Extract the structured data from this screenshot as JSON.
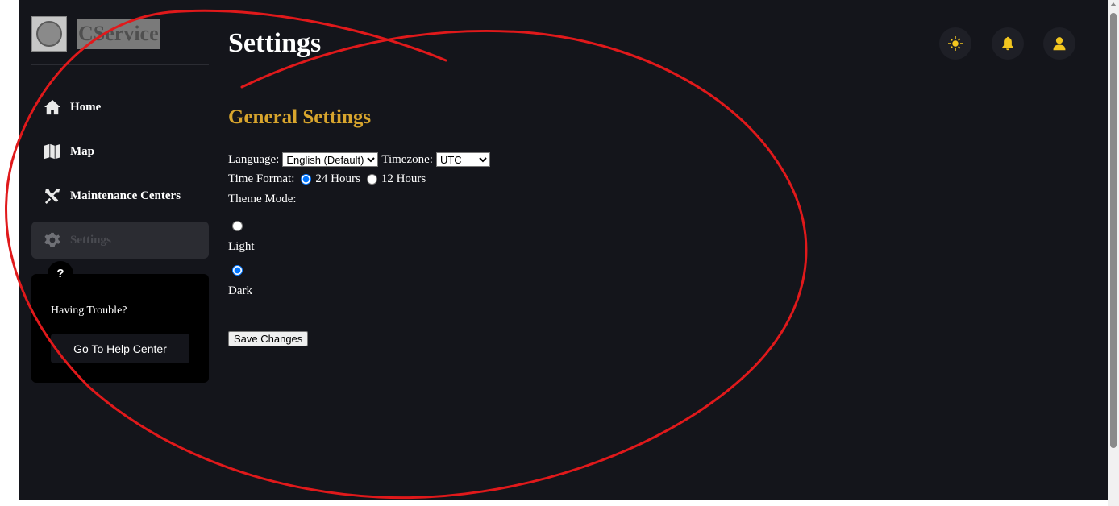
{
  "brand": {
    "name": "CService"
  },
  "sidebar": {
    "items": [
      {
        "label": "Home",
        "icon": "home-icon"
      },
      {
        "label": "Map",
        "icon": "map-icon"
      },
      {
        "label": "Maintenance Centers",
        "icon": "tools-icon"
      },
      {
        "label": "Settings",
        "icon": "gear-icon",
        "active": true
      }
    ]
  },
  "help": {
    "badge": "?",
    "text": "Having Trouble?",
    "button": "Go To Help Center"
  },
  "header": {
    "title": "Settings"
  },
  "settings": {
    "section_title": "General Settings",
    "language_label": "Language:",
    "language_value": "English (Default)",
    "timezone_label": "Timezone:",
    "timezone_value": "UTC",
    "time_format_label": "Time Format:",
    "time_format_options": [
      "24 Hours",
      "12 Hours"
    ],
    "time_format_selected": "24 Hours",
    "theme_label": "Theme Mode:",
    "theme_options": [
      "Light",
      "Dark"
    ],
    "theme_selected": "Dark",
    "save_label": "Save Changes"
  },
  "colors": {
    "accent": "#d8a52d",
    "icon_yellow": "#f2c61f",
    "background": "#14151b",
    "annotation": "#e0191b"
  }
}
